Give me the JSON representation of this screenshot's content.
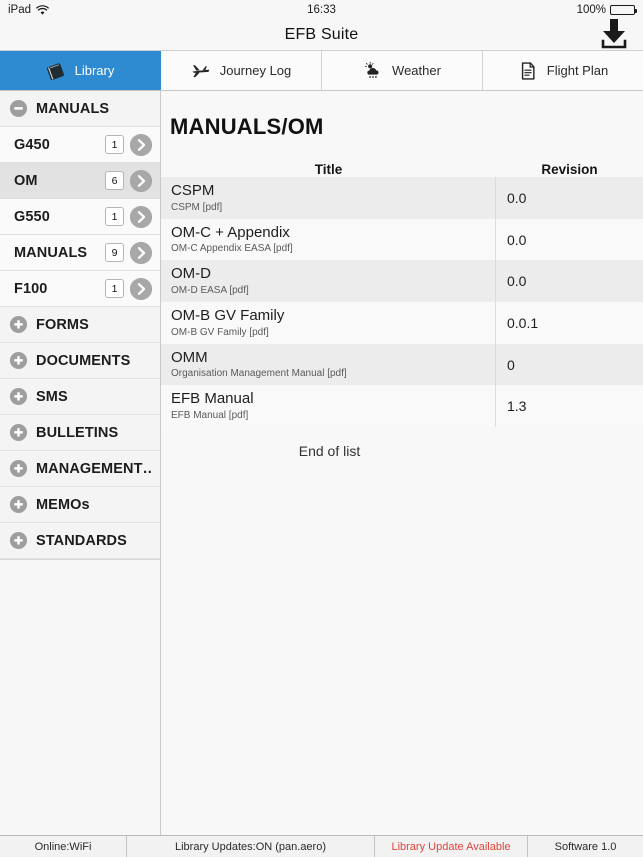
{
  "statusbar": {
    "device": "iPad",
    "wifi_icon": "wifi-icon",
    "time": "16:33",
    "battery_percent": "100%",
    "battery_icon": "battery-full-icon"
  },
  "titlebar": {
    "title": "EFB Suite",
    "download_icon": "download-icon"
  },
  "tabs": [
    {
      "label": "Library",
      "icon": "book-icon",
      "active": true
    },
    {
      "label": "Journey Log",
      "icon": "airplane-icon",
      "active": false
    },
    {
      "label": "Weather",
      "icon": "cloud-sun-rain-icon",
      "active": false
    },
    {
      "label": "Flight Plan",
      "icon": "document-icon",
      "active": false
    }
  ],
  "sidebar": {
    "items": [
      {
        "label": "MANUALS",
        "icon": "minus-circle-icon",
        "type": "group",
        "badge": null,
        "chevron": false,
        "selected": false
      },
      {
        "label": "G450",
        "icon": null,
        "type": "child",
        "badge": "1",
        "chevron": true,
        "selected": false
      },
      {
        "label": "OM",
        "icon": null,
        "type": "child",
        "badge": "6",
        "chevron": true,
        "selected": true
      },
      {
        "label": "G550",
        "icon": null,
        "type": "child",
        "badge": "1",
        "chevron": true,
        "selected": false
      },
      {
        "label": "MANUALS",
        "icon": null,
        "type": "child",
        "badge": "9",
        "chevron": true,
        "selected": false
      },
      {
        "label": "F100",
        "icon": null,
        "type": "child",
        "badge": "1",
        "chevron": true,
        "selected": false
      },
      {
        "label": "FORMS",
        "icon": "plus-circle-icon",
        "type": "group",
        "badge": null,
        "chevron": false,
        "selected": false
      },
      {
        "label": "DOCUMENTS",
        "icon": "plus-circle-icon",
        "type": "group",
        "badge": null,
        "chevron": false,
        "selected": false
      },
      {
        "label": "SMS",
        "icon": "plus-circle-icon",
        "type": "group",
        "badge": null,
        "chevron": false,
        "selected": false
      },
      {
        "label": "BULLETINS",
        "icon": "plus-circle-icon",
        "type": "group",
        "badge": null,
        "chevron": false,
        "selected": false
      },
      {
        "label": "MANAGEMENT…",
        "icon": "plus-circle-icon",
        "type": "group",
        "badge": null,
        "chevron": false,
        "selected": false
      },
      {
        "label": "MEMOs",
        "icon": "plus-circle-icon",
        "type": "group",
        "badge": null,
        "chevron": false,
        "selected": false
      },
      {
        "label": "STANDARDS",
        "icon": "plus-circle-icon",
        "type": "group",
        "badge": null,
        "chevron": false,
        "selected": false
      }
    ]
  },
  "main": {
    "page_title": "MANUALS/OM",
    "columns": [
      "Title",
      "Revision"
    ],
    "rows": [
      {
        "title": "CSPM",
        "subtitle": "CSPM [pdf]",
        "revision": "0.0"
      },
      {
        "title": "OM-C + Appendix",
        "subtitle": "OM-C Appendix EASA [pdf]",
        "revision": "0.0"
      },
      {
        "title": "OM-D",
        "subtitle": "OM-D EASA [pdf]",
        "revision": "0.0"
      },
      {
        "title": "OM-B GV Family",
        "subtitle": "OM-B GV Family [pdf]",
        "revision": "0.0.1"
      },
      {
        "title": "OMM",
        "subtitle": "Organisation Management Manual [pdf]",
        "revision": "0"
      },
      {
        "title": "EFB Manual",
        "subtitle": "EFB Manual [pdf]",
        "revision": "1.3"
      }
    ],
    "end_of_list": "End of list"
  },
  "footer": {
    "online": "Online:WiFi",
    "library_updates": "Library Updates:ON   (pan.aero)",
    "update_available": "Library Update Available",
    "software": "Software 1.0"
  },
  "colors": {
    "accent": "#2e8bd1",
    "alert": "#e0463c",
    "row_odd": "#ececec",
    "row_even": "#f9f9f9",
    "selected": "#e2e2e2"
  }
}
